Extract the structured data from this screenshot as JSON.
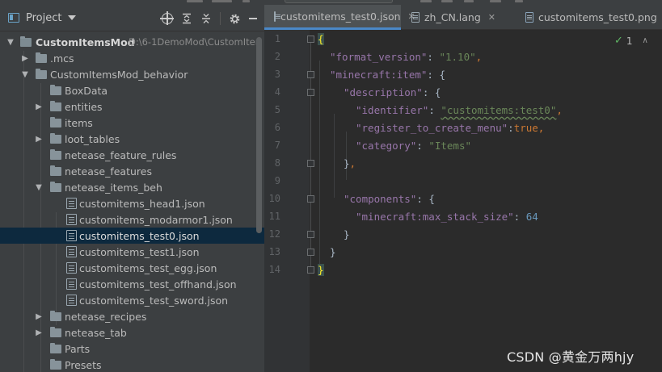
{
  "project_panel": {
    "title": "Project",
    "tree": [
      {
        "label": "CustomItemsMod",
        "path": "D:\\6-1DemoMod\\CustomIter"
      },
      {
        "label": ".mcs"
      },
      {
        "label": "CustomItemsMod_behavior"
      },
      {
        "label": "BoxData"
      },
      {
        "label": "entities"
      },
      {
        "label": "items"
      },
      {
        "label": "loot_tables"
      },
      {
        "label": "netease_feature_rules"
      },
      {
        "label": "netease_features"
      },
      {
        "label": "netease_items_beh"
      },
      {
        "label": "customitems_head1.json"
      },
      {
        "label": "customitems_modarmor1.json"
      },
      {
        "label": "customitems_test0.json"
      },
      {
        "label": "customitems_test1.json"
      },
      {
        "label": "customitems_test_egg.json"
      },
      {
        "label": "customitems_test_offhand.json"
      },
      {
        "label": "customitems_test_sword.json"
      },
      {
        "label": "netease_recipes"
      },
      {
        "label": "netease_tab"
      },
      {
        "label": "Parts"
      },
      {
        "label": "Presets"
      }
    ]
  },
  "editor": {
    "tabs": [
      "customitems_test0.json",
      "zh_CN.lang",
      "customitems_test0.png"
    ],
    "inspection_count": "1",
    "line_numbers": [
      "1",
      "2",
      "3",
      "4",
      "5",
      "6",
      "7",
      "8",
      "9",
      "10",
      "11",
      "12",
      "13",
      "14"
    ],
    "code": {
      "l2_key": "\"format_version\"",
      "l2_val": "\"1.10\"",
      "l3_key": "\"minecraft:item\"",
      "l4_key": "\"description\"",
      "l5_key": "\"identifier\"",
      "l5_val": "\"customitems:test0\"",
      "l6_key": "\"register_to_create_menu\"",
      "l6_val": "true",
      "l7_key": "\"category\"",
      "l7_val": "\"Items\"",
      "l10_key": "\"components\"",
      "l11_key": "\"minecraft:max_stack_size\"",
      "l11_val": "64"
    }
  },
  "watermark": "CSDN @黄金万两hjy",
  "colors": {
    "background": "#2b2b2b",
    "panel": "#3c3f41",
    "selection": "#0d293e",
    "json_key": "#9876aa",
    "json_string": "#6a8759",
    "json_number": "#6897bb",
    "json_keyword": "#cc7832",
    "tab_underline": "#4a88c7"
  }
}
